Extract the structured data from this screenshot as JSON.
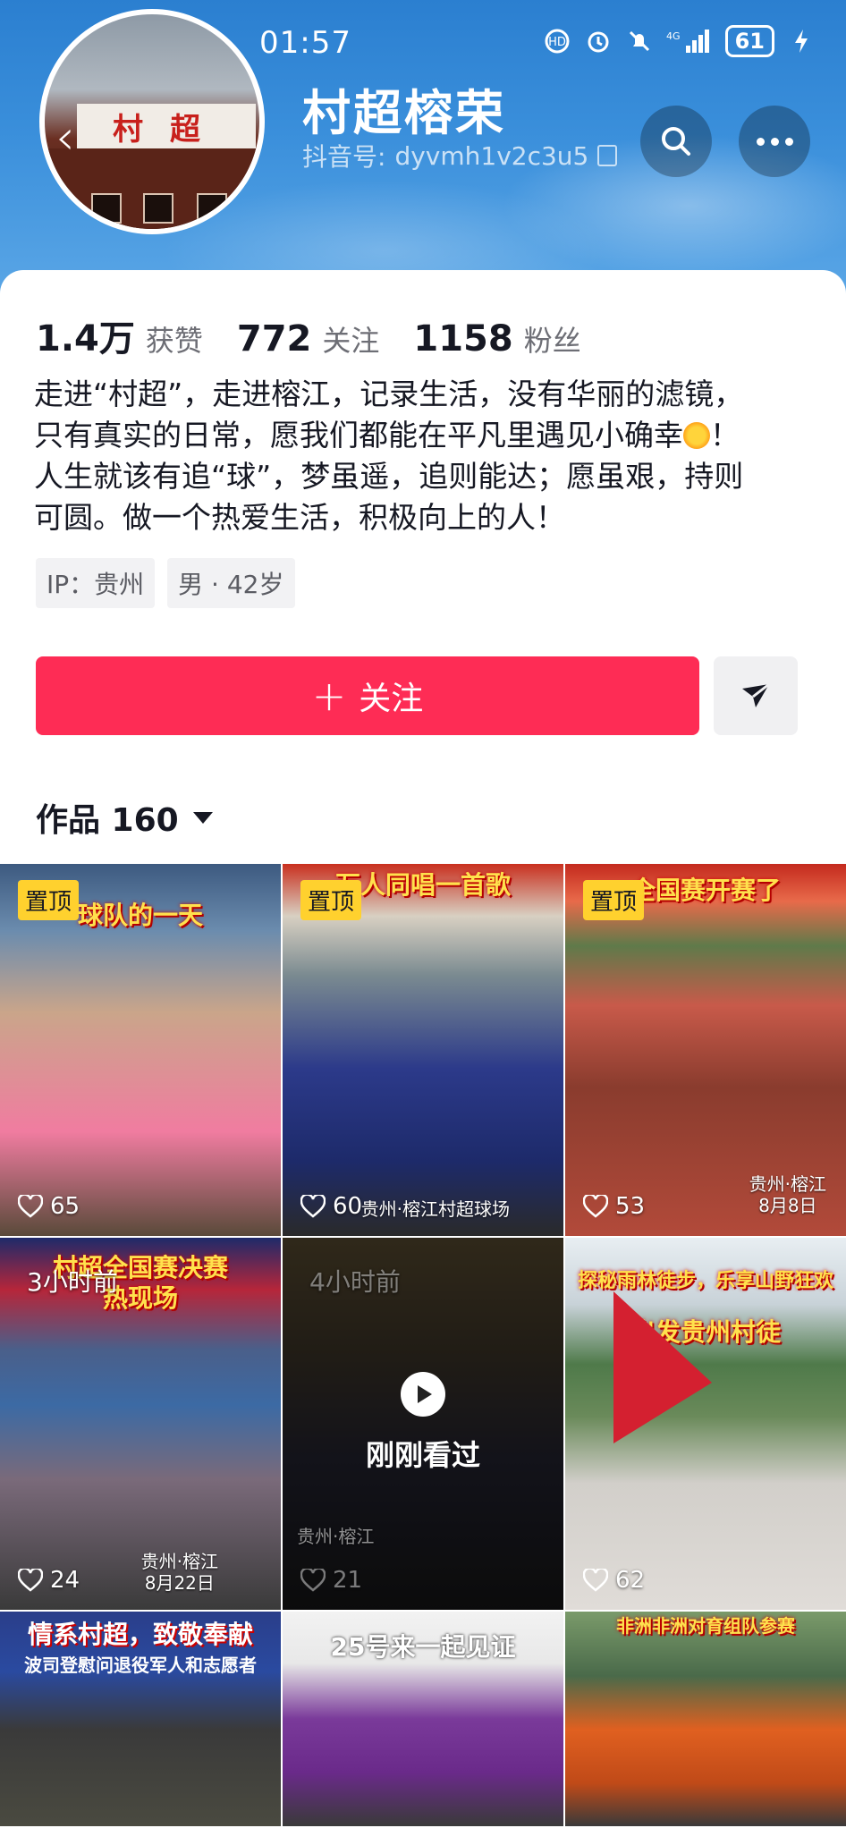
{
  "status_bar": {
    "time": "01:57",
    "battery": "61",
    "network": "4G"
  },
  "profile": {
    "name": "村超榕荣",
    "douyin_id_label": "抖音号:",
    "douyin_id": "dyvmh1v2c3u5",
    "avatar_sign_left": "村",
    "avatar_sign_right": "超",
    "stats": [
      {
        "value": "1.4万",
        "label": "获赞"
      },
      {
        "value": "772",
        "label": "关注"
      },
      {
        "value": "1158",
        "label": "粉丝"
      }
    ],
    "bio_lines": [
      "走进“村超”，走进榕江，记录生活，没有华丽的滤镜，",
      "只有真实的日常，愿我们都能在平凡里遇见小确幸",
      "人生就该有追“球”，梦虽遥，追则能达；愿虽艰，持则",
      "可圆。做一个热爱生活，积极向上的人！"
    ],
    "bio_line2_end": "！",
    "tags": [
      "IP：贵州",
      "男 · 42岁"
    ],
    "follow_label": "关注",
    "works_label": "作品 160"
  },
  "videos": [
    {
      "pinned": "置顶",
      "banner": "球队的一天",
      "likes": "65"
    },
    {
      "pinned": "置顶",
      "banner": "万人同唱一首歌",
      "likes": "60",
      "location": "贵州·榕江村超球场"
    },
    {
      "pinned": "置顶",
      "banner": "全国赛开赛了",
      "likes": "53",
      "location": "贵州·榕江",
      "date": "8月8日"
    },
    {
      "time_ago": "3小时前",
      "banner": "村超全国赛决赛",
      "banner2": "热现场",
      "likes": "24",
      "location": "贵州·榕江",
      "date": "8月22日"
    },
    {
      "time_ago": "4小时前",
      "watched": "刚刚看过",
      "likes": "21",
      "location": "贵州·榕江"
    },
    {
      "banner": "探秘雨林徒步，乐享山野狂欢",
      "banner2": "出发贵州村徒",
      "likes": "62"
    },
    {
      "banner": "情系村超，致敬奉献",
      "banner2": "波司登慰问退役军人和志愿者"
    },
    {
      "banner": "25号来一起见证"
    },
    {
      "banner": "非洲非洲对育组队参赛"
    }
  ],
  "colors": {
    "follow": "#fe2c55",
    "pin": "#ffd12e",
    "header_sky": "#3a8fdb"
  }
}
